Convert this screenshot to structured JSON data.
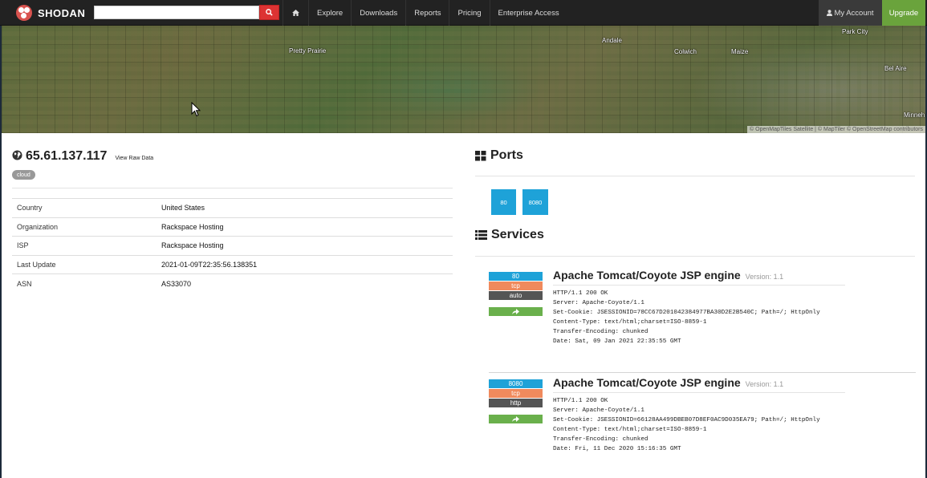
{
  "navbar": {
    "brand": "Shodan",
    "search": {
      "value": "",
      "placeholder": ""
    },
    "items": [
      "Explore",
      "Downloads",
      "Reports",
      "Pricing",
      "Enterprise Access"
    ],
    "account": "My Account",
    "upgrade": "Upgrade"
  },
  "map": {
    "labels": [
      "Pretty Prairie",
      "Andale",
      "Colwich",
      "Maize",
      "Park City",
      "Bel Aire",
      "Minneh"
    ],
    "attribution": "© OpenMapTiles Satellite | © MapTiler © OpenStreetMap contributors"
  },
  "host": {
    "ip": "65.61.137.117",
    "raw_link": "View Raw Data",
    "tag": "cloud",
    "rows": [
      {
        "key": "Country",
        "value": "United States"
      },
      {
        "key": "Organization",
        "value": "Rackspace Hosting"
      },
      {
        "key": "ISP",
        "value": "Rackspace Hosting"
      },
      {
        "key": "Last Update",
        "value": "2021-01-09T22:35:56.138351"
      },
      {
        "key": "ASN",
        "value": "AS33070"
      }
    ]
  },
  "ports": {
    "title": "Ports",
    "list": [
      "80",
      "8080"
    ]
  },
  "services": {
    "title": "Services",
    "items": [
      {
        "port": "80",
        "transport": "tcp",
        "module": "auto",
        "product": "Apache Tomcat/Coyote JSP engine",
        "version": "Version: 1.1",
        "banner": "HTTP/1.1 200 OK\nServer: Apache-Coyote/1.1\nSet-Cookie: JSESSIONID=78CC67D201042384977BA30D2E2B540C; Path=/; HttpOnly\nContent-Type: text/html;charset=ISO-8859-1\nTransfer-Encoding: chunked\nDate: Sat, 09 Jan 2021 22:35:55 GMT"
      },
      {
        "port": "8080",
        "transport": "tcp",
        "module": "http",
        "product": "Apache Tomcat/Coyote JSP engine",
        "version": "Version: 1.1",
        "banner": "HTTP/1.1 200 OK\nServer: Apache-Coyote/1.1\nSet-Cookie: JSESSIONID=66128AA499DBEB07D8EF0AC9D035EA79; Path=/; HttpOnly\nContent-Type: text/html;charset=ISO-8859-1\nTransfer-Encoding: chunked\nDate: Fri, 11 Dec 2020 15:16:35 GMT"
      }
    ]
  },
  "colors": {
    "navbar": "#222222",
    "search_button": "#dd3333",
    "upgrade": "#6aa33c",
    "port_blue": "#1ea2d8",
    "proto_orange": "#f08a5d",
    "module_gray": "#555555",
    "share_green": "#6ab04c"
  },
  "icons": [
    "shodan-logo-icon",
    "search-icon",
    "home-icon",
    "user-icon",
    "globe-icon",
    "th-large-icon",
    "list-icon",
    "share-icon",
    "mouse-cursor-icon"
  ]
}
